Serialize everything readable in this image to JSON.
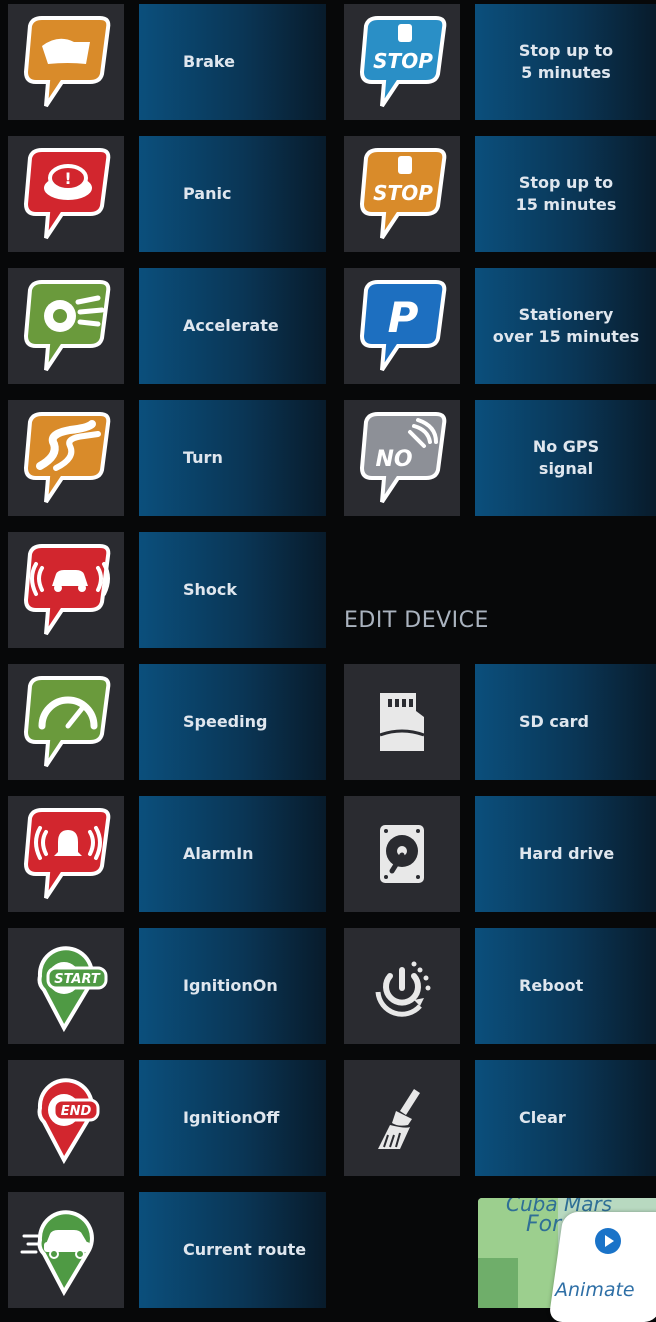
{
  "left_events": [
    {
      "label": "Brake",
      "icon": "brake-icon",
      "color": "#d98b2a"
    },
    {
      "label": "Panic",
      "icon": "panic-icon",
      "color": "#d2262e"
    },
    {
      "label": "Accelerate",
      "icon": "accelerate-icon",
      "color": "#6a9a3c"
    },
    {
      "label": "Turn",
      "icon": "turn-icon",
      "color": "#d98b2a"
    },
    {
      "label": "Shock",
      "icon": "shock-icon",
      "color": "#d2262e"
    },
    {
      "label": "Speeding",
      "icon": "speeding-icon",
      "color": "#6a9a3c"
    },
    {
      "label": "AlarmIn",
      "icon": "alarm-bell-icon",
      "color": "#d2262e"
    },
    {
      "label": "IgnitionOn",
      "icon": "ignition-start-icon",
      "color": "#4f9a44",
      "badge": "START"
    },
    {
      "label": "IgnitionOff",
      "icon": "ignition-end-icon",
      "color": "#d2262e",
      "badge": "END"
    },
    {
      "label": "Current route",
      "icon": "current-route-car-icon",
      "color": "#4f9a44"
    }
  ],
  "right_events": [
    {
      "label": "Stop up to\n5 minutes",
      "icon": "stop-5-min-icon",
      "color": "#2a8fc6",
      "badge": "STOP"
    },
    {
      "label": "Stop up to\n15 minutes",
      "icon": "stop-15-min-icon",
      "color": "#d98b2a",
      "badge": "STOP"
    },
    {
      "label": "Stationery\nover 15 minutes",
      "icon": "parking-icon",
      "color": "#1d6fc0",
      "badge": "P"
    },
    {
      "label": "No GPS\nsignal",
      "icon": "no-gps-icon",
      "color": "#8d9097",
      "badge": "NO"
    }
  ],
  "edit_device": {
    "title": "EDIT DEVICE",
    "items": [
      {
        "label": "SD card",
        "icon": "sd-card-icon"
      },
      {
        "label": "Hard drive",
        "icon": "hard-drive-icon"
      },
      {
        "label": "Reboot",
        "icon": "reboot-icon"
      },
      {
        "label": "Clear",
        "icon": "clear-broom-icon"
      }
    ]
  },
  "map_preview": {
    "text_top": "Cuba Mars",
    "text_mid": "Fore",
    "animate_label": "Animate"
  }
}
